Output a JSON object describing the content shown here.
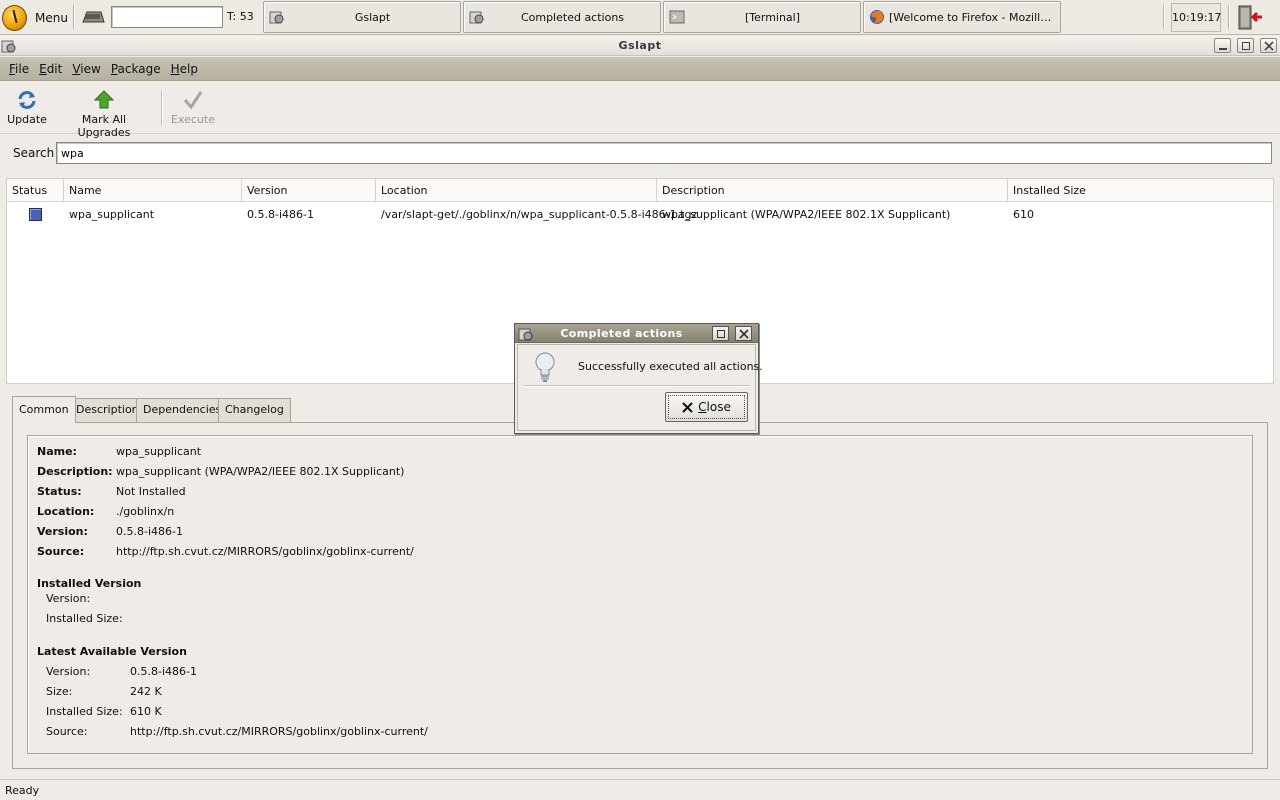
{
  "taskbar": {
    "menu_label": "Menu",
    "tasks_count": "T: 53",
    "run_value": "",
    "tasks": [
      {
        "label": "Gslapt",
        "icon": "gslapt-icon"
      },
      {
        "label": "Completed actions",
        "icon": "gslapt-icon"
      },
      {
        "label": "[Terminal]",
        "icon": "terminal-icon"
      },
      {
        "label": "[Welcome to Firefox - Mozilla Fir...",
        "icon": "firefox-icon"
      }
    ],
    "clock": "10:19:17"
  },
  "window": {
    "title": "Gslapt"
  },
  "menubar": {
    "items": [
      {
        "accel": "F",
        "rest": "ile"
      },
      {
        "accel": "E",
        "rest": "dit"
      },
      {
        "accel": "V",
        "rest": "iew"
      },
      {
        "accel": "P",
        "rest": "ackage"
      },
      {
        "accel": "H",
        "rest": "elp"
      }
    ]
  },
  "toolbar": {
    "update_label": "Update",
    "mark_all_label": "Mark All Upgrades",
    "execute_label": "Execute"
  },
  "search": {
    "label": "Search",
    "value": "wpa"
  },
  "package_list": {
    "columns": [
      "Status",
      "Name",
      "Version",
      "Location",
      "Description",
      "Installed Size"
    ],
    "rows": [
      {
        "status": "not-installed",
        "name": "wpa_supplicant",
        "version": "0.5.8-i486-1",
        "location": "/var/slapt-get/./goblinx/n/wpa_supplicant-0.5.8-i486-1.tgz",
        "description": "wpa_supplicant (WPA/WPA2/IEEE 802.1X Supplicant)",
        "installed_size": "610"
      }
    ]
  },
  "tabs": [
    "Common",
    "Description",
    "Dependencies",
    "Changelog"
  ],
  "details": {
    "name_label": "Name:",
    "name": "wpa_supplicant",
    "description_label": "Description:",
    "description": "wpa_supplicant (WPA/WPA2/IEEE 802.1X Supplicant)",
    "status_label": "Status:",
    "status": "Not Installed",
    "location_label": "Location:",
    "location": "./goblinx/n",
    "version_label": "Version:",
    "version": "0.5.8-i486-1",
    "source_label": "Source:",
    "source": "http://ftp.sh.cvut.cz/MIRRORS/goblinx/goblinx-current/",
    "installed_heading": "Installed Version",
    "installed_version_label": "Version:",
    "installed_version": "",
    "installed_size_label": "Installed Size:",
    "installed_size": "",
    "latest_heading": "Latest Available Version",
    "latest_version_label": "Version:",
    "latest_version": "0.5.8-i486-1",
    "latest_size_label": "Size:",
    "latest_size": "242 K",
    "latest_installed_size_label": "Installed Size:",
    "latest_installed_size": "610 K",
    "latest_source_label": "Source:",
    "latest_source": "http://ftp.sh.cvut.cz/MIRRORS/goblinx/goblinx-current/"
  },
  "statusbar": {
    "text": "Ready"
  },
  "dialog": {
    "title": "Completed actions",
    "message": "Successfully executed all actions.",
    "close_accel": "C",
    "close_rest": "lose"
  },
  "colors": {
    "status_not_installed": "#4a62b8",
    "menubar": "#bdb8a8",
    "dialog_title": "#9a9584"
  }
}
